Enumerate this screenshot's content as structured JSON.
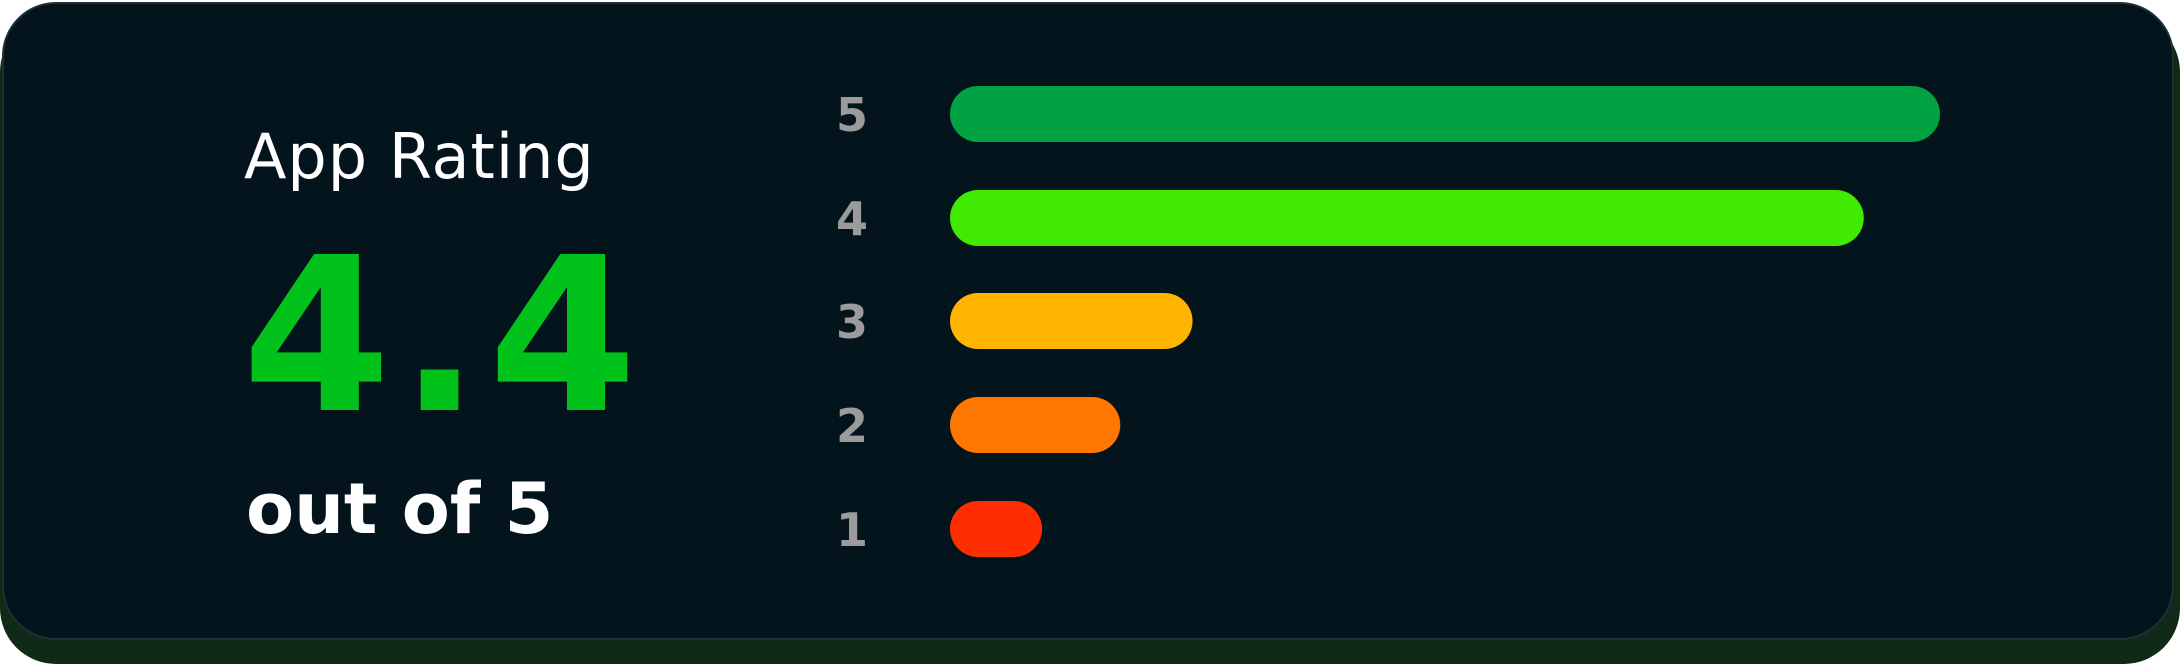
{
  "header": {
    "title": "App Rating"
  },
  "summary": {
    "score": "4.4",
    "out_of": "out of 5"
  },
  "colors": {
    "score": "#01c21b",
    "tick": "#9b9b9b",
    "card_bg": "#04141c",
    "card_shadow": "#0f2a17"
  },
  "chart_data": {
    "type": "bar",
    "orientation": "horizontal",
    "categories": [
      "5",
      "4",
      "3",
      "2",
      "1"
    ],
    "values": [
      100,
      92.3,
      24.5,
      17.2,
      9.3
    ],
    "bar_colors": [
      "#00a241",
      "#40eb01",
      "#ffb500",
      "#ff7700",
      "#ff2e00"
    ],
    "xlim": [
      0,
      100
    ],
    "title": "",
    "xlabel": "",
    "ylabel": "",
    "grid": false,
    "legend": "none"
  }
}
